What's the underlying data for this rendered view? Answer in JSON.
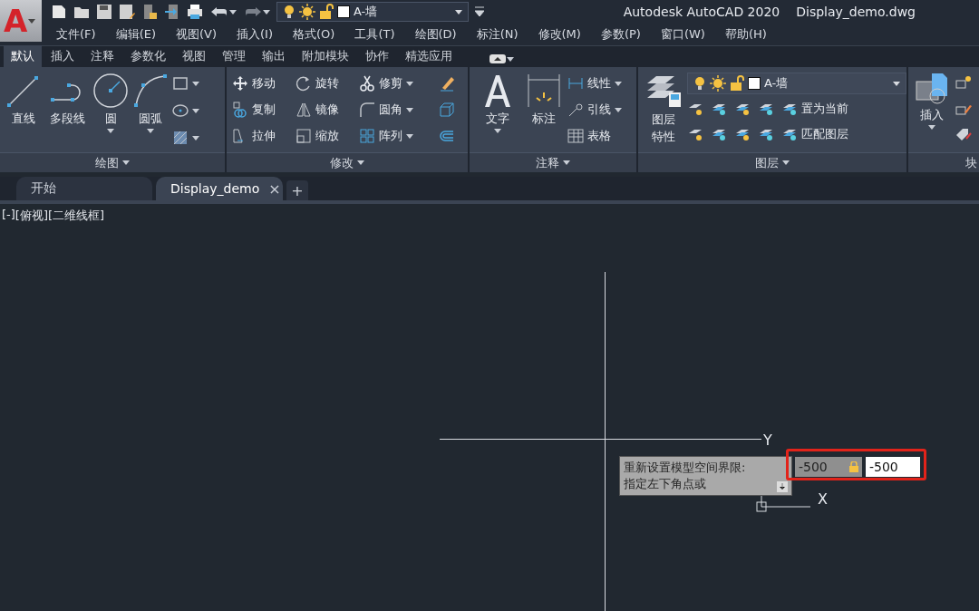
{
  "app_button": {
    "logo_letter": "A"
  },
  "quick_layer": {
    "name": "A-墙"
  },
  "title": {
    "app": "Autodesk AutoCAD 2020",
    "file": "Display_demo.dwg"
  },
  "menu": [
    "文件(F)",
    "编辑(E)",
    "视图(V)",
    "插入(I)",
    "格式(O)",
    "工具(T)",
    "绘图(D)",
    "标注(N)",
    "修改(M)",
    "参数(P)",
    "窗口(W)",
    "帮助(H)"
  ],
  "ribbon_tabs": [
    {
      "label": "默认",
      "selected": true
    },
    {
      "label": "插入",
      "selected": false
    },
    {
      "label": "注释",
      "selected": false
    },
    {
      "label": "参数化",
      "selected": false
    },
    {
      "label": "视图",
      "selected": false
    },
    {
      "label": "管理",
      "selected": false
    },
    {
      "label": "输出",
      "selected": false
    },
    {
      "label": "附加模块",
      "selected": false
    },
    {
      "label": "协作",
      "selected": false
    },
    {
      "label": "精选应用",
      "selected": false
    }
  ],
  "panels": {
    "draw": {
      "title": "绘图",
      "tools": [
        {
          "label": "直线",
          "dropdown": false
        },
        {
          "label": "多段线",
          "dropdown": false
        },
        {
          "label": "圆",
          "dropdown": true
        },
        {
          "label": "圆弧",
          "dropdown": true
        }
      ]
    },
    "modify": {
      "title": "修改",
      "rows": [
        [
          {
            "label": "移动",
            "dropdown": false
          },
          {
            "label": "旋转",
            "dropdown": false
          },
          {
            "label": "修剪",
            "dropdown": true
          }
        ],
        [
          {
            "label": "复制",
            "dropdown": false
          },
          {
            "label": "镜像",
            "dropdown": false
          },
          {
            "label": "圆角",
            "dropdown": true
          }
        ],
        [
          {
            "label": "拉伸",
            "dropdown": false
          },
          {
            "label": "缩放",
            "dropdown": false
          },
          {
            "label": "阵列",
            "dropdown": true
          }
        ]
      ]
    },
    "annotation": {
      "title": "注释",
      "big": [
        {
          "label": "文字",
          "dropdown": true
        },
        {
          "label": "标注",
          "dropdown": false
        }
      ],
      "small": [
        {
          "label": "线性",
          "dropdown": true
        },
        {
          "label": "引线",
          "dropdown": true
        },
        {
          "label": "表格",
          "dropdown": false
        }
      ]
    },
    "layers": {
      "title": "图层",
      "properties": "图层特性",
      "layer": {
        "name": "A-墙"
      },
      "actions": [
        "置为当前",
        "匹配图层"
      ]
    },
    "block": {
      "title": "块",
      "insert": "插入"
    }
  },
  "doc_tabs": [
    {
      "label": "开始",
      "selected": false
    },
    {
      "label": "Display_demo",
      "selected": true,
      "close": "×"
    }
  ],
  "new_tab": "+",
  "viewport_controls": [
    "[-]",
    "[俯视]",
    "[二维线框]"
  ],
  "ucs": {
    "y_label": "Y",
    "x_label": "X"
  },
  "prompt": {
    "lines": [
      "重新设置模型空间界限:",
      "指定左下角点或"
    ]
  },
  "inputs": [
    {
      "value": "-500",
      "locked": true,
      "active": false
    },
    {
      "value": "-500",
      "locked": false,
      "active": true
    }
  ]
}
